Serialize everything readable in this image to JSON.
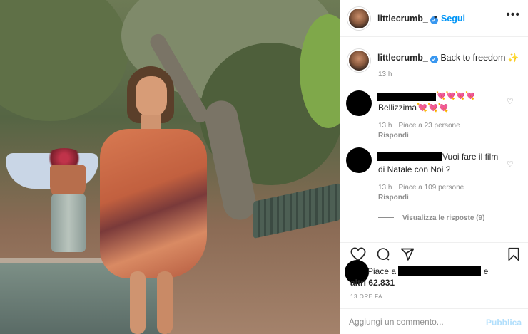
{
  "post": {
    "username": "littlecrumb_",
    "follow_label": "Segui",
    "dot": "•",
    "more_label": "•••"
  },
  "caption": {
    "username": "littlecrumb_",
    "text": "Back to freedom ✨",
    "time": "13 h"
  },
  "comments": [
    {
      "text": "Bellizzima💘💘💘",
      "hearts_inline": "💘💘💘💘",
      "time": "13 h",
      "likes": "Piace a 23 persone",
      "reply": "Rispondi"
    },
    {
      "text_line1": "Vuoi fare il film",
      "text_line2": "di Natale con Noi ?",
      "time": "13 h",
      "likes": "Piace a 109 persone",
      "reply": "Rispondi"
    }
  ],
  "view_replies": "Visualizza le risposte (9)",
  "likes": {
    "prefix": "Piace a",
    "suffix": "e",
    "others": "altri 62.831"
  },
  "post_time": "13 ORE FA",
  "comment_input": {
    "placeholder": "Aggiungi un commento...",
    "publish_label": "Pubblica"
  },
  "colors": {
    "accent": "#0095f6",
    "verified": "#3897f0",
    "muted": "#8e8e8e",
    "publish_disabled": "#b2dffc"
  },
  "icons": [
    "verified-badge-icon",
    "more-options-icon",
    "heart-icon",
    "comment-icon",
    "share-icon",
    "bookmark-icon",
    "comment-like-icon"
  ]
}
